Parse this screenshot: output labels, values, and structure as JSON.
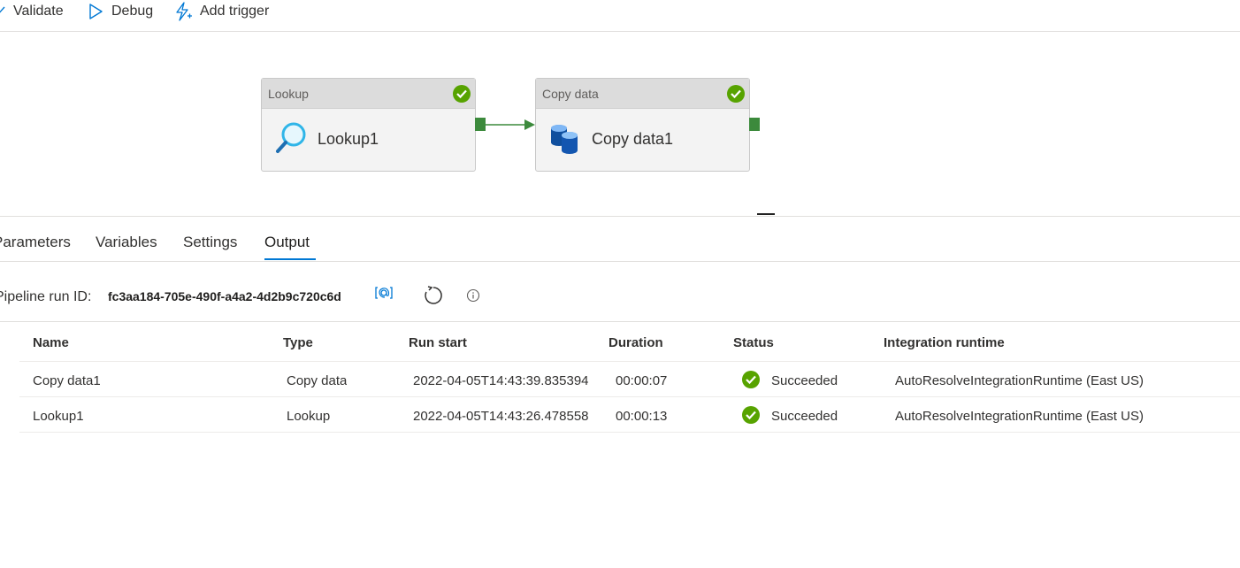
{
  "toolbar": {
    "validate_label": "Validate",
    "debug_label": "Debug",
    "trigger_label": "Add trigger"
  },
  "pipeline": {
    "nodes": [
      {
        "type_label": "Lookup",
        "name": "Lookup1",
        "status_icon": "check-circle-icon"
      },
      {
        "type_label": "Copy data",
        "name": "Copy data1",
        "status_icon": "check-circle-icon"
      }
    ]
  },
  "tabs": [
    "Parameters",
    "Variables",
    "Settings",
    "Output"
  ],
  "active_tab": "Output",
  "output": {
    "run_id_label": "Pipeline run ID:",
    "run_id": "fc3aa184-705e-490f-a4a2-4d2b9c720c6d"
  },
  "table": {
    "headers": [
      "Name",
      "Type",
      "Run start",
      "Duration",
      "Status",
      "Integration runtime"
    ],
    "rows": [
      {
        "name": "Copy data1",
        "type": "Copy data",
        "run_start": "2022-04-05T14:43:39.835394",
        "duration": "00:00:07",
        "status": "Succeeded",
        "runtime": "AutoResolveIntegrationRuntime (East US)"
      },
      {
        "name": "Lookup1",
        "type": "Lookup",
        "run_start": "2022-04-05T14:43:26.478558",
        "duration": "00:00:13",
        "status": "Succeeded",
        "runtime": "AutoResolveIntegrationRuntime (East US)"
      }
    ]
  },
  "colors": {
    "accent": "#0078d4",
    "success": "#57a300",
    "port": "#3c8a3c"
  }
}
